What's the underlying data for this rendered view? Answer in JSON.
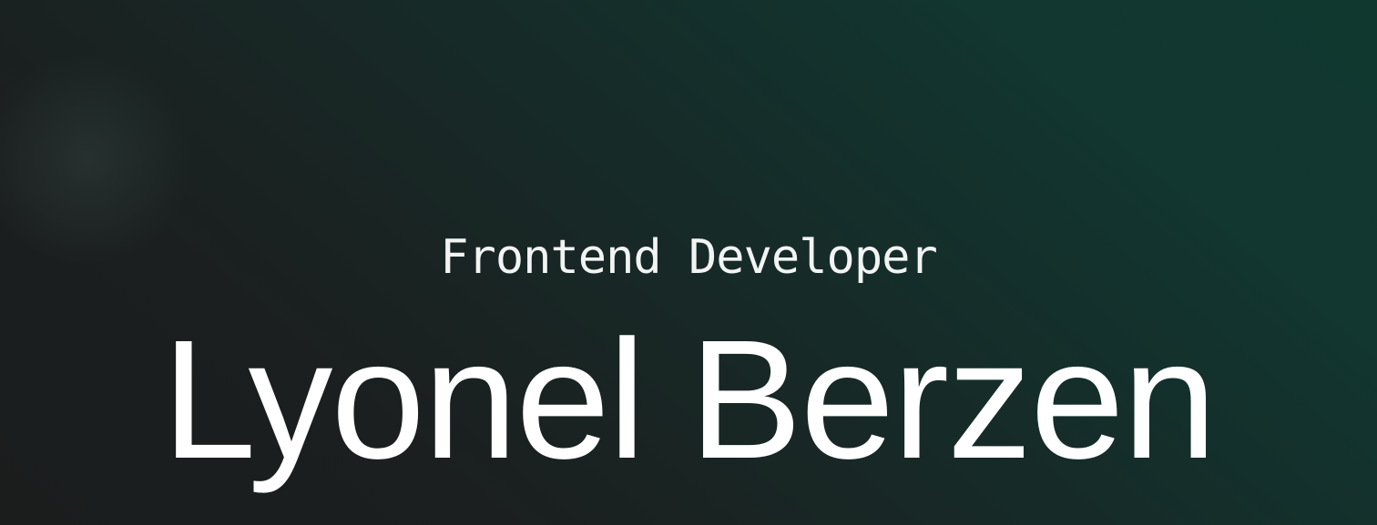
{
  "hero": {
    "role": "Frontend Developer",
    "name": "Lyonel Berzen"
  },
  "colors": {
    "text": "#ffffff",
    "background_start": "#1b1d1d",
    "background_end": "#10382f"
  }
}
